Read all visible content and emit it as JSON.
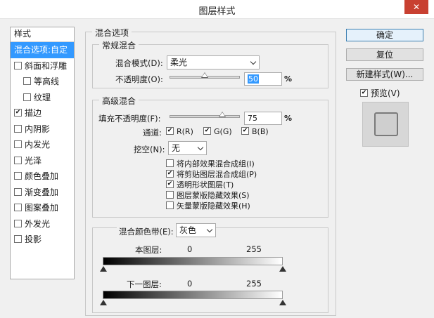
{
  "dialog": {
    "title": "图层样式",
    "close": "✕"
  },
  "styles_panel": {
    "header": "样式",
    "items": [
      {
        "label": "混合选项:自定",
        "checkbox": false,
        "checked": false,
        "selected": true,
        "sub": false
      },
      {
        "label": "斜面和浮雕",
        "checkbox": true,
        "checked": false,
        "selected": false,
        "sub": false
      },
      {
        "label": "等高线",
        "checkbox": true,
        "checked": false,
        "selected": false,
        "sub": true
      },
      {
        "label": "纹理",
        "checkbox": true,
        "checked": false,
        "selected": false,
        "sub": true
      },
      {
        "label": "描边",
        "checkbox": true,
        "checked": true,
        "selected": false,
        "sub": false
      },
      {
        "label": "内阴影",
        "checkbox": true,
        "checked": false,
        "selected": false,
        "sub": false
      },
      {
        "label": "内发光",
        "checkbox": true,
        "checked": false,
        "selected": false,
        "sub": false
      },
      {
        "label": "光泽",
        "checkbox": true,
        "checked": false,
        "selected": false,
        "sub": false
      },
      {
        "label": "颜色叠加",
        "checkbox": true,
        "checked": false,
        "selected": false,
        "sub": false
      },
      {
        "label": "渐变叠加",
        "checkbox": true,
        "checked": false,
        "selected": false,
        "sub": false
      },
      {
        "label": "图案叠加",
        "checkbox": true,
        "checked": false,
        "selected": false,
        "sub": false
      },
      {
        "label": "外发光",
        "checkbox": true,
        "checked": false,
        "selected": false,
        "sub": false
      },
      {
        "label": "投影",
        "checkbox": true,
        "checked": false,
        "selected": false,
        "sub": false
      }
    ]
  },
  "blending": {
    "section_title": "混合选项",
    "general": {
      "title": "常规混合",
      "mode_label": "混合模式(D):",
      "mode_value": "柔光",
      "opacity_label": "不透明度(O):",
      "opacity_value": "50",
      "opacity_level": 0.5,
      "opacity_unit": "%"
    },
    "advanced": {
      "title": "高级混合",
      "fill_label": "填充不透明度(F):",
      "fill_value": "75",
      "fill_level": 0.75,
      "fill_unit": "%",
      "channels_label": "通道:",
      "channels": [
        {
          "label": "R(R)",
          "checked": true
        },
        {
          "label": "G(G)",
          "checked": true
        },
        {
          "label": "B(B)",
          "checked": true
        }
      ],
      "knockout_label": "挖空(N):",
      "knockout_value": "无",
      "options": [
        {
          "label": "将内部效果混合成组(I)",
          "checked": false
        },
        {
          "label": "将剪贴图层混合成组(P)",
          "checked": true
        },
        {
          "label": "透明形状图层(T)",
          "checked": true
        },
        {
          "label": "图层蒙版隐藏效果(S)",
          "checked": false
        },
        {
          "label": "矢量蒙版隐藏效果(H)",
          "checked": false
        }
      ]
    },
    "blend_if": {
      "label": "混合颜色带(E):",
      "value": "灰色",
      "this_layer_label": "本图层:",
      "this_min": "0",
      "this_max": "255",
      "under_layer_label": "下一图层:",
      "under_min": "0",
      "under_max": "255"
    }
  },
  "buttons": {
    "ok": "确定",
    "reset": "复位",
    "new_style": "新建样式(W)...",
    "preview_label": "预览(V)",
    "preview_checked": true
  }
}
